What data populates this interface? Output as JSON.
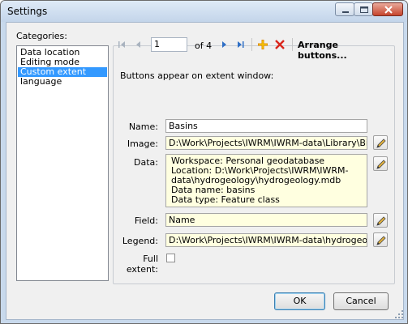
{
  "window": {
    "title": "Settings"
  },
  "categories": {
    "label": "Categories:",
    "items": [
      "Data location",
      "Editing mode",
      "Custom extent",
      "language"
    ],
    "selected": "Custom extent"
  },
  "toolbar": {
    "position": "1",
    "of_text": "of 4",
    "arrange_label": "Arrange buttons..."
  },
  "panel": {
    "caption": "Buttons appear on extent window:",
    "name_label": "Name:",
    "name_value": "Basins",
    "image_label": "Image:",
    "image_value": "D:\\Work\\Projects\\IWRM\\IWRM-data\\Library\\Bitmaps\\ex",
    "data_label": "Data:",
    "data_value": "Workspace: Personal geodatabase\nLocation: D:\\Work\\Projects\\IWRM\\IWRM-\ndata\\hydrogeology\\hydrogeology.mdb\nData name: basins\nData type: Feature class",
    "field_label": "Field:",
    "field_value": "Name",
    "legend_label": "Legend:",
    "legend_value": "D:\\Work\\Projects\\IWRM\\IWRM-data\\hydrogeology\\laye",
    "full_extent_label": "Full extent:",
    "full_extent_checked": false
  },
  "buttons": {
    "ok": "OK",
    "cancel": "Cancel"
  },
  "colors": {
    "selection": "#3399ff",
    "yellow_field": "#ffffe0",
    "delete_red": "#d9261c",
    "add_yellow": "#f5b400"
  }
}
